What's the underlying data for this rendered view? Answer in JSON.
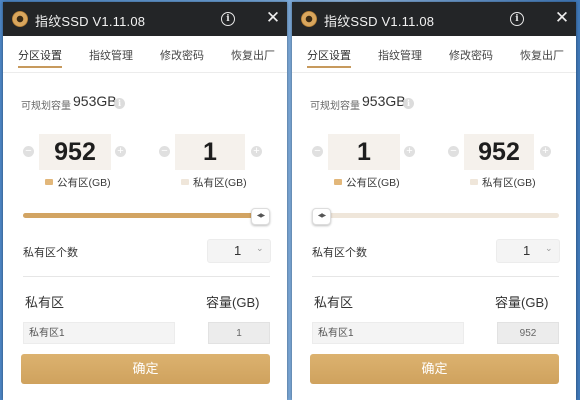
{
  "colors": {
    "titlebar": "#232527",
    "accent": "#c79a5d",
    "slider_fill": "#d2a463",
    "slider_track": "#efe6da",
    "public_swatch": "#e2b77a",
    "private_swatch": "#efe6da"
  },
  "windows": [
    {
      "title": "指纹SSD V1.11.08",
      "tabs": [
        "分区设置",
        "指纹管理",
        "修改密码",
        "恢复出厂"
      ],
      "active_tab": 0,
      "capacity_label": "可规划容量",
      "capacity_value": "953GB",
      "public_value": "952",
      "public_label": "公有区(GB)",
      "private_value": "1",
      "private_label": "私有区(GB)",
      "slider_public_fraction": 0.999,
      "private_count_label": "私有区个数",
      "private_count": "1",
      "table_header_name": "私有区",
      "table_header_capacity": "容量(GB)",
      "partition_name": "私有区1",
      "partition_capacity": "1",
      "confirm_label": "确定",
      "icons": {
        "logo": "disc-logo-icon",
        "info": "info-icon",
        "close": "close-icon",
        "minus": "minus-icon",
        "plus": "plus-icon",
        "chevron": "chevron-down-icon"
      }
    },
    {
      "title": "指纹SSD V1.11.08",
      "tabs": [
        "分区设置",
        "指纹管理",
        "修改密码",
        "恢复出厂"
      ],
      "active_tab": 0,
      "capacity_label": "可规划容量",
      "capacity_value": "953GB",
      "public_value": "1",
      "public_label": "公有区(GB)",
      "private_value": "952",
      "private_label": "私有区(GB)",
      "slider_public_fraction": 0.001,
      "private_count_label": "私有区个数",
      "private_count": "1",
      "table_header_name": "私有区",
      "table_header_capacity": "容量(GB)",
      "partition_name": "私有区1",
      "partition_capacity": "952",
      "confirm_label": "确定",
      "icons": {
        "logo": "disc-logo-icon",
        "info": "info-icon",
        "close": "close-icon",
        "minus": "minus-icon",
        "plus": "plus-icon",
        "chevron": "chevron-down-icon"
      }
    }
  ]
}
